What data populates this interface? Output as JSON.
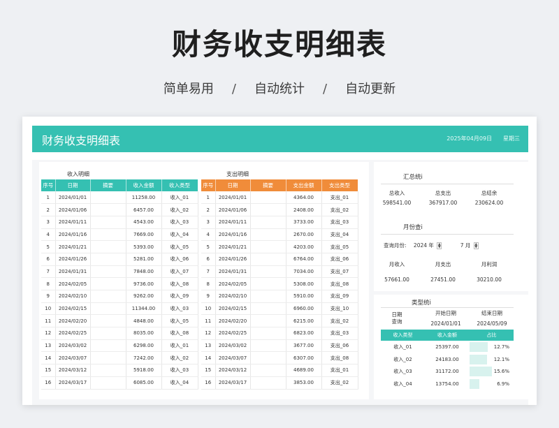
{
  "hero": {
    "title": "财务收支明细表",
    "tags": [
      "简单易用",
      "自动统计",
      "自动更新"
    ],
    "separator": "/"
  },
  "banner": {
    "title": "财务收支明细表",
    "date": "2025年04月09日",
    "weekday": "星期三"
  },
  "income": {
    "caption": "收入明细",
    "headers": [
      "序号",
      "日期",
      "摘要",
      "收入金额",
      "收入类型"
    ],
    "rows": [
      [
        "1",
        "2024/01/01",
        "",
        "11258.00",
        "收入_01"
      ],
      [
        "2",
        "2024/01/06",
        "",
        "6457.00",
        "收入_02"
      ],
      [
        "3",
        "2024/01/11",
        "",
        "4543.00",
        "收入_03"
      ],
      [
        "4",
        "2024/01/16",
        "",
        "7669.00",
        "收入_04"
      ],
      [
        "5",
        "2024/01/21",
        "",
        "5393.00",
        "收入_05"
      ],
      [
        "6",
        "2024/01/26",
        "",
        "5281.00",
        "收入_06"
      ],
      [
        "7",
        "2024/01/31",
        "",
        "7848.00",
        "收入_07"
      ],
      [
        "8",
        "2024/02/05",
        "",
        "9736.00",
        "收入_08"
      ],
      [
        "9",
        "2024/02/10",
        "",
        "9262.00",
        "收入_09"
      ],
      [
        "10",
        "2024/02/15",
        "",
        "11344.00",
        "收入_03"
      ],
      [
        "11",
        "2024/02/20",
        "",
        "4848.00",
        "收入_05"
      ],
      [
        "12",
        "2024/02/25",
        "",
        "8035.00",
        "收入_08"
      ],
      [
        "13",
        "2024/03/02",
        "",
        "6298.00",
        "收入_01"
      ],
      [
        "14",
        "2024/03/07",
        "",
        "7242.00",
        "收入_02"
      ],
      [
        "15",
        "2024/03/12",
        "",
        "5918.00",
        "收入_03"
      ],
      [
        "16",
        "2024/03/17",
        "",
        "6085.00",
        "收入_04"
      ]
    ]
  },
  "expense": {
    "caption": "支出明细",
    "headers": [
      "序号",
      "日期",
      "摘要",
      "支出金额",
      "支出类型"
    ],
    "rows": [
      [
        "1",
        "2024/01/01",
        "",
        "4364.00",
        "支出_01"
      ],
      [
        "2",
        "2024/01/06",
        "",
        "2408.00",
        "支出_02"
      ],
      [
        "3",
        "2024/01/11",
        "",
        "3733.00",
        "支出_03"
      ],
      [
        "4",
        "2024/01/16",
        "",
        "2670.00",
        "支出_04"
      ],
      [
        "5",
        "2024/01/21",
        "",
        "4203.00",
        "支出_05"
      ],
      [
        "6",
        "2024/01/26",
        "",
        "6764.00",
        "支出_06"
      ],
      [
        "7",
        "2024/01/31",
        "",
        "7034.00",
        "支出_07"
      ],
      [
        "8",
        "2024/02/05",
        "",
        "5308.00",
        "支出_08"
      ],
      [
        "9",
        "2024/02/10",
        "",
        "5910.00",
        "支出_09"
      ],
      [
        "10",
        "2024/02/15",
        "",
        "6960.00",
        "支出_10"
      ],
      [
        "11",
        "2024/02/20",
        "",
        "6215.00",
        "支出_02"
      ],
      [
        "12",
        "2024/02/25",
        "",
        "6823.00",
        "支出_03"
      ],
      [
        "13",
        "2024/03/02",
        "",
        "3677.00",
        "支出_06"
      ],
      [
        "14",
        "2024/03/07",
        "",
        "6307.00",
        "支出_08"
      ],
      [
        "15",
        "2024/03/12",
        "",
        "4689.00",
        "支出_01"
      ],
      [
        "16",
        "2024/03/17",
        "",
        "3853.00",
        "支出_02"
      ]
    ]
  },
  "summary": {
    "title": "汇总统i",
    "labels": [
      "总收入",
      "总支出",
      "总结余"
    ],
    "values": [
      "598541.00",
      "367917.00",
      "230624.00"
    ]
  },
  "monthly": {
    "title": "月份查i",
    "query_label": "查询月份:",
    "year": "2024",
    "year_unit": "年",
    "month": "7",
    "month_unit": "月",
    "labels": [
      "月收入",
      "月支出",
      "月利润"
    ],
    "values": [
      "57661.00",
      "27451.00",
      "30210.00"
    ]
  },
  "types": {
    "title": "类型统i",
    "query_label": "日期\n查询",
    "start_label": "开始日期",
    "end_label": "结束日期",
    "start": "2024/01/01",
    "end": "2024/05/09",
    "headers": [
      "收入类型",
      "收入金额",
      "占比"
    ],
    "rows": [
      {
        "type": "收入_01",
        "amount": "25397.00",
        "pct_text": "12.7%",
        "pct": 0.127
      },
      {
        "type": "收入_02",
        "amount": "24183.00",
        "pct_text": "12.1%",
        "pct": 0.121
      },
      {
        "type": "收入_03",
        "amount": "31172.00",
        "pct_text": "15.6%",
        "pct": 0.156
      },
      {
        "type": "收入_04",
        "amount": "13754.00",
        "pct_text": "6.9%",
        "pct": 0.069
      }
    ]
  }
}
